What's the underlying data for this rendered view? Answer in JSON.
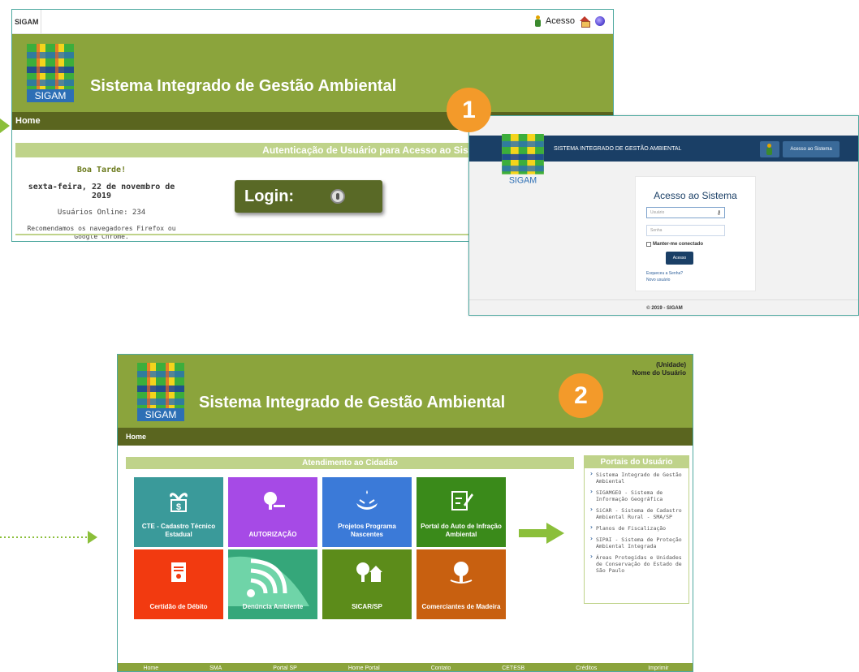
{
  "colors": {
    "olive": "#8ba43c",
    "dark_olive": "#5a651f",
    "light_olive": "#bfd38a",
    "navy": "#1a3f66",
    "badge": "#f39a2a"
  },
  "legacy": {
    "brand": "SIGAM",
    "access_label": "Acesso",
    "logo_text": "SIGAM",
    "title": "Sistema Integrado de Gestão Ambiental",
    "nav_home": "Home",
    "auth_title": "Autenticação de Usuário para Acesso ao Sistema",
    "greeting": "Boa Tarde!",
    "date": "sexta-feira, 22 de novembro de 2019",
    "online": "Usuários Online: 234",
    "recommend": "Recomendamos os navegadores Firefox ou Google Chrome.",
    "login_label": "Login:"
  },
  "badge1": "1",
  "badge2": "2",
  "newlogin": {
    "logo_text": "SIGAM",
    "system_name": "SISTEMA INTEGRADO DE GESTÃO AMBIENTAL",
    "access_button": "Acesso ao Sistema",
    "heading": "Acesso ao Sistema",
    "user_placeholder": "Usuário",
    "password_placeholder": "Senha",
    "remember": "Manter-me conectado",
    "submit": "Acesso",
    "forgot": "Esqueceu a Senha?",
    "new_user": "Novo usuário",
    "footer": "© 2019 - SIGAM"
  },
  "dashboard": {
    "logo_text": "SIGAM",
    "title": "Sistema Integrado de Gestão Ambiental",
    "unit": "(Unidade)",
    "user_name": "Nome do Usuário",
    "nav_home": "Home",
    "section_title": "Atendimento ao Cidadão",
    "tiles": [
      {
        "label": "CTE - Cadastro Técnico Estadual",
        "color": "#3a9a9a",
        "icon": "money-plant-icon"
      },
      {
        "label": "AUTORIZAÇÃO",
        "color": "#a64ae6",
        "icon": "tree-cut-icon"
      },
      {
        "label": "Projetos Programa Nascentes",
        "color": "#3b7ad8",
        "icon": "water-hands-icon"
      },
      {
        "label": "Portal do Auto de Infração Ambiental",
        "color": "#3a8a1a",
        "icon": "edit-document-icon"
      },
      {
        "label": "Certidão de Débito",
        "color": "#f23a10",
        "icon": "certificate-icon"
      },
      {
        "label": "Denúncia Ambiente",
        "color": "#35a77a",
        "icon": "signal-icon"
      },
      {
        "label": "SICAR/SP",
        "color": "#5c8c1a",
        "icon": "trees-house-icon"
      },
      {
        "label": "Comerciantes de Madeira",
        "color": "#c86010",
        "icon": "tree-hands-icon"
      }
    ],
    "portals_title": "Portais do Usuário",
    "portals": [
      "Sistema Integrado de Gestão Ambiental",
      "SIGAMGEO - Sistema de Informação Geográfica",
      "SiCAR - Sistema de Cadastro Ambiental Rural - SMA/SP",
      "Planos de Fiscalização",
      "SIPAI - Sistema de Proteção Ambiental Integrada",
      "Áreas Protegidas e Unidades de Conservação do Estado de São Paulo"
    ],
    "footer_links": [
      "Home",
      "SMA",
      "Portal SP",
      "Home Portal",
      "Contato",
      "CETESB",
      "Créditos",
      "Imprimir"
    ]
  }
}
